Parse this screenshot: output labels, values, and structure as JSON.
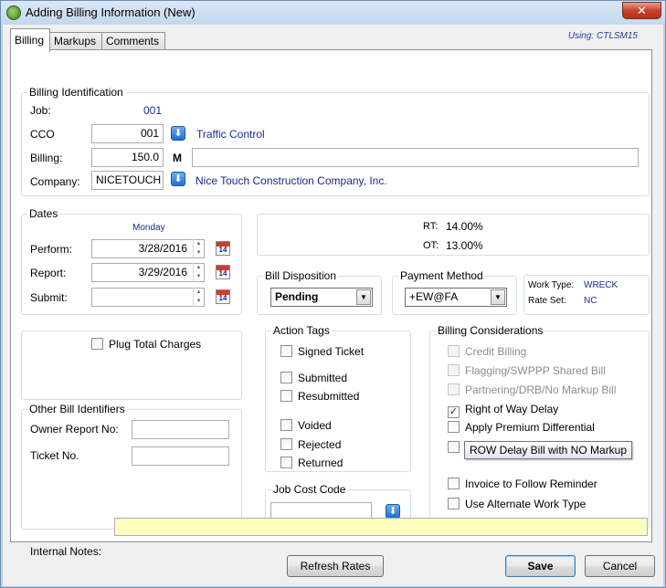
{
  "window": {
    "title": "Adding Billing Information  (New)",
    "close_glyph": "✕"
  },
  "tabs": [
    {
      "label": "Billing",
      "active": true
    },
    {
      "label": "Markups",
      "active": false
    },
    {
      "label": "Comments",
      "active": false
    }
  ],
  "using": "Using:  CTLSM15",
  "billing_identification": {
    "legend": "Billing Identification",
    "job_label": "Job:",
    "job_value": "001",
    "cco_label": "CCO",
    "cco_value": "001",
    "cco_desc": "Traffic Control",
    "billing_label": "Billing:",
    "billing_value": "150.0",
    "billing_unit": "M",
    "billing_desc": "",
    "company_label": "Company:",
    "company_value": "NICETOUCH",
    "company_desc": "Nice Touch Construction Company, Inc."
  },
  "dates": {
    "legend": "Dates",
    "weekday": "Monday",
    "perform_label": "Perform:",
    "perform_value": "3/28/2016",
    "report_label": "Report:",
    "report_value": "3/29/2016",
    "submit_label": "Submit:",
    "submit_value": "",
    "cal_day": "14"
  },
  "rates": {
    "rt_label": "RT:",
    "rt_value": "14.00%",
    "ot_label": "OT:",
    "ot_value": "13.00%"
  },
  "bill_disposition": {
    "legend": "Bill Disposition",
    "value": "Pending"
  },
  "payment_method": {
    "legend": "Payment Method",
    "value": "+EW@FA"
  },
  "work_info": {
    "work_type_label": "Work Type:",
    "work_type_value": "WRECK",
    "rate_set_label": "Rate Set:",
    "rate_set_value": "NC"
  },
  "plug_total_charges": {
    "label": "Plug Total Charges",
    "checked": false
  },
  "other_bill_identifiers": {
    "legend": "Other Bill Identifiers",
    "owner_report_label": "Owner Report No:",
    "owner_report_value": "",
    "ticket_label": "Ticket No.",
    "ticket_value": ""
  },
  "action_tags": {
    "legend": "Action Tags",
    "items": [
      {
        "label": "Signed Ticket",
        "checked": false
      },
      {
        "label": "Submitted",
        "checked": false
      },
      {
        "label": "Resubmitted",
        "checked": false
      },
      {
        "label": "Voided",
        "checked": false
      },
      {
        "label": "Rejected",
        "checked": false
      },
      {
        "label": "Returned",
        "checked": false
      }
    ]
  },
  "job_cost_code": {
    "legend": "Job Cost Code",
    "value": ""
  },
  "billing_considerations": {
    "legend": "Billing Considerations",
    "items": [
      {
        "label": "Credit Billing",
        "checked": false,
        "enabled": false
      },
      {
        "label": "Flagging/SWPPP Shared Bill",
        "checked": false,
        "enabled": false
      },
      {
        "label": "Partnering/DRB/No Markup Bill",
        "checked": false,
        "enabled": false
      },
      {
        "label": "Right of Way Delay",
        "checked": true,
        "enabled": true
      },
      {
        "label": "Apply Premium Differential",
        "checked": false,
        "enabled": true
      },
      {
        "label": "",
        "checked": false,
        "enabled": true
      },
      {
        "label": "Invoice to Follow Reminder",
        "checked": false,
        "enabled": true
      },
      {
        "label": "Use Alternate Work Type",
        "checked": false,
        "enabled": true
      }
    ],
    "tooltip": "ROW Delay Bill with NO Markup"
  },
  "internal_notes": {
    "label": "Internal Notes:",
    "value": ""
  },
  "buttons": {
    "refresh": "Refresh Rates",
    "save": "Save",
    "cancel": "Cancel"
  },
  "check_glyph": "✓",
  "dropdown_glyph": "▼",
  "arrow_glyph": "⬇"
}
